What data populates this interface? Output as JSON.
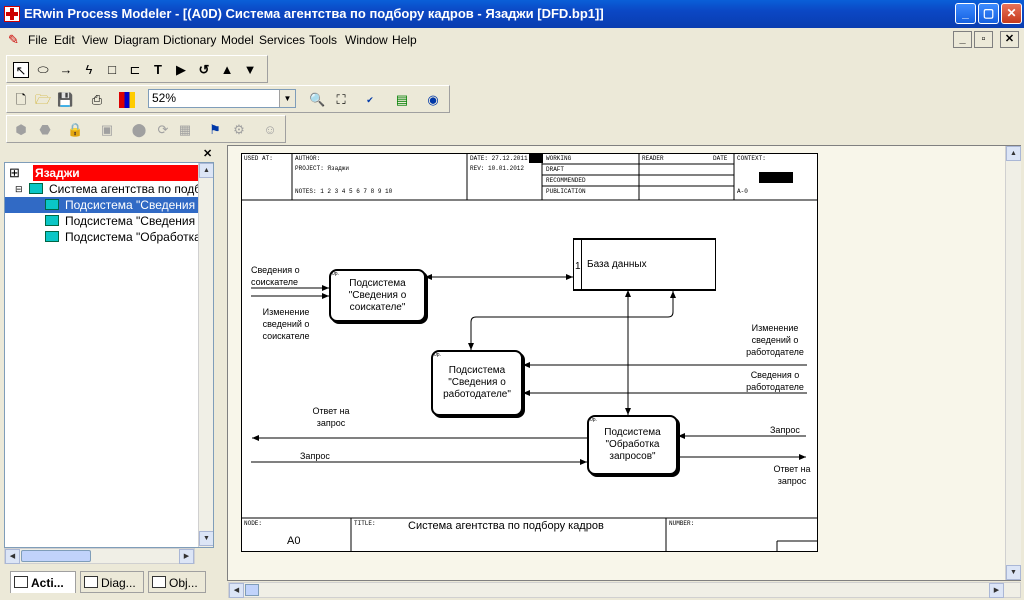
{
  "window": {
    "title": "ERwin Process Modeler - [(A0D) Система агентства по подбору кадров - Язаджи  [DFD.bp1]]",
    "min": "_",
    "max": "▢",
    "close": "✕"
  },
  "menu": {
    "items": [
      "File",
      "Edit",
      "View",
      "Diagram",
      "Dictionary",
      "Model",
      "Services",
      "Tools",
      "Window",
      "Help"
    ]
  },
  "toolbar": {
    "zoom_value": "52%"
  },
  "tree": {
    "root": "Язаджи",
    "node": "Система агентства по подбо",
    "children": [
      "Подсистема \"Сведения о",
      "Подсистема \"Сведения о",
      "Подсистема \"Обработка"
    ]
  },
  "tabs": [
    "Acti...",
    "Diag...",
    "Obj..."
  ],
  "frame": {
    "used_at": "USED AT:",
    "author": "AUTHOR:",
    "project": "PROJECT:  Язаджи",
    "date": "DATE: 27.12.2011",
    "rev": "REV:  10.01.2012",
    "notes": "NOTES:  1  2  3  4  5  6  7  8  9  10",
    "working": "WORKING",
    "draft": "DRAFT",
    "recommended": "RECOMMENDED",
    "publication": "PUBLICATION",
    "reader": "READER",
    "date2": "DATE",
    "context": "CONTEXT:",
    "node_ref": "A-0",
    "node_label": "NODE:",
    "node_value": "A0",
    "title_label": "TITLE:",
    "title_value": "Система агентства по подбору кадров",
    "number_label": "NUMBER:"
  },
  "diagram": {
    "box1": "Подсистема \"Сведения о соискателе\"",
    "box2": "Подсистема \"Сведения о работодателе\"",
    "box3": "Подсистема \"Обработка запросов\"",
    "box_tag": "0р.",
    "store_num": "1",
    "store": "База данных",
    "in1": "Сведения о соискателе",
    "in2": "Изменение сведений о соискателе",
    "in3": "Изменение сведений о работодателе",
    "in4": "Сведения о работодателе",
    "out1": "Ответ на запрос",
    "in5": "Запрос",
    "in6": "Запрос",
    "out2": "Ответ на запрос"
  }
}
